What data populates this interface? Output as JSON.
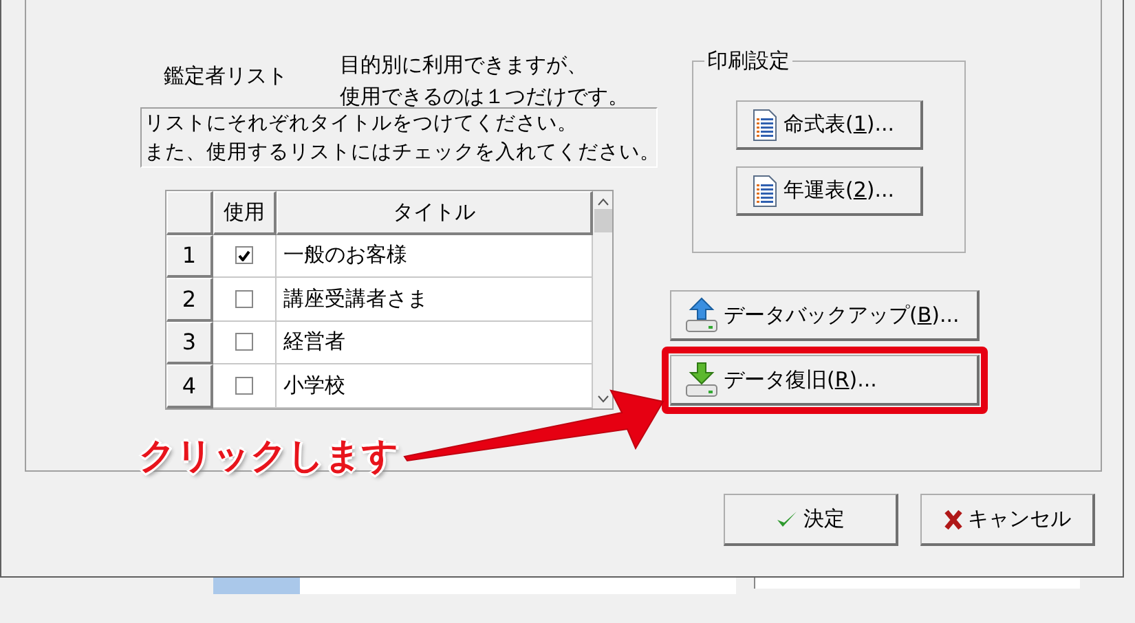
{
  "list_section": {
    "title": "鑑定者リスト",
    "note": [
      "目的別に利用できますが、",
      "使用できるのは１つだけです。"
    ],
    "instructions": [
      "リストにそれぞれタイトルをつけてください。",
      "また、使用するリストにはチェックを入れてください。"
    ]
  },
  "table": {
    "columns": [
      "使用",
      "タイトル"
    ],
    "rows": [
      {
        "number": "1",
        "checked": true,
        "title": "一般のお客様"
      },
      {
        "number": "2",
        "checked": false,
        "title": "講座受講者さま"
      },
      {
        "number": "3",
        "checked": false,
        "title": "経営者"
      },
      {
        "number": "4",
        "checked": false,
        "title": "小学校"
      }
    ]
  },
  "print_settings": {
    "title": "印刷設定",
    "buttons": [
      {
        "before": "命式表(",
        "key": "1",
        "after": ")..."
      },
      {
        "before": "年運表(",
        "key": "2",
        "after": ")..."
      }
    ]
  },
  "data_buttons": [
    {
      "kind": "backup",
      "before": "データバックアップ(",
      "key": "B",
      "after": ")...",
      "highlighted": false
    },
    {
      "kind": "restore",
      "before": "データ復旧(",
      "key": "R",
      "after": ")...",
      "highlighted": true
    }
  ],
  "annotation": {
    "text": "クリックします"
  },
  "dialog_buttons": [
    {
      "kind": "ok",
      "label": "決定"
    },
    {
      "kind": "cancel",
      "label": "キャンセル"
    }
  ]
}
